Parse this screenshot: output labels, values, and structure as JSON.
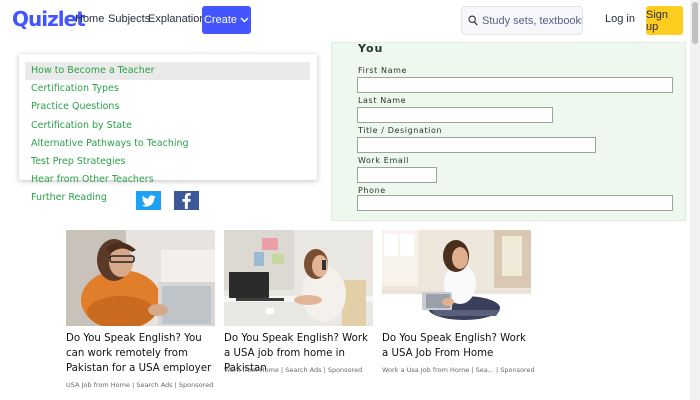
{
  "header": {
    "logo": "Quizlet",
    "nav": [
      "Home",
      "Subjects",
      "Explanations"
    ],
    "create_label": "Create",
    "search_placeholder": "Study sets, textbooks, ...",
    "login_label": "Log in",
    "signup_label": "Sign up",
    "brand_color": "#4255ff",
    "signup_color": "#ffcd1f"
  },
  "article_nav": {
    "items": [
      "How to Become a Teacher",
      "Certification Types",
      "Practice Questions",
      "Certification by State",
      "Alternative Pathways to Teaching",
      "Test Prep Strategies",
      "Hear from Other Teachers",
      "Further Reading"
    ],
    "highlighted_index": 0,
    "link_color": "#2aa14a"
  },
  "social": {
    "twitter_icon": "twitter-icon",
    "facebook_icon": "facebook-icon"
  },
  "form": {
    "title": "You",
    "fields": [
      {
        "label": "First Name",
        "value": ""
      },
      {
        "label": "Last Name",
        "value": ""
      },
      {
        "label": "Title / Designation",
        "value": ""
      },
      {
        "label": "Work Email",
        "value": ""
      },
      {
        "label": "Phone",
        "value": ""
      }
    ]
  },
  "ads": [
    {
      "headline": "Do You Speak English? You can work remotely from Pakistan for a USA employer",
      "source": "USA Job from Home",
      "network": "Search Ads",
      "sponsored": "Sponsored"
    },
    {
      "headline": "Do You Speak English? Work a USA job from home in Pakistan",
      "source": "Work from Home",
      "network": "Search Ads",
      "sponsored": "Sponsored"
    },
    {
      "headline": "Do You Speak English? Work a USA Job From Home",
      "source": "Work a Usa Job from Home",
      "network": "Sea...",
      "sponsored": "Sponsored"
    }
  ]
}
